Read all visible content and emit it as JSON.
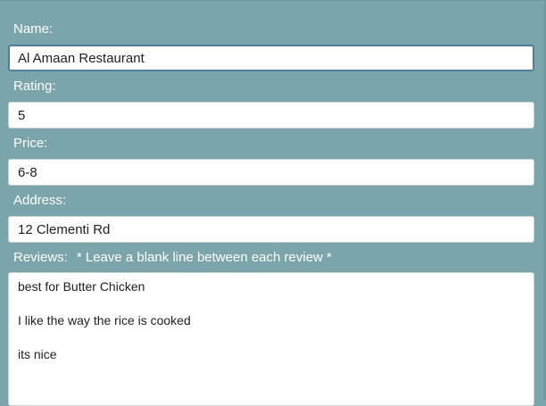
{
  "form": {
    "name": {
      "label": "Name:",
      "value": "Al Amaan Restaurant"
    },
    "rating": {
      "label": "Rating:",
      "value": "5"
    },
    "price": {
      "label": "Price:",
      "value": "6-8"
    },
    "address": {
      "label": "Address:",
      "value": "12 Clementi Rd"
    },
    "reviews": {
      "label": "Reviews:",
      "hint": "* Leave a blank line between each review *",
      "value": "best for Butter Chicken\n\nI like the way the rice is cooked\n\nits nice"
    }
  }
}
